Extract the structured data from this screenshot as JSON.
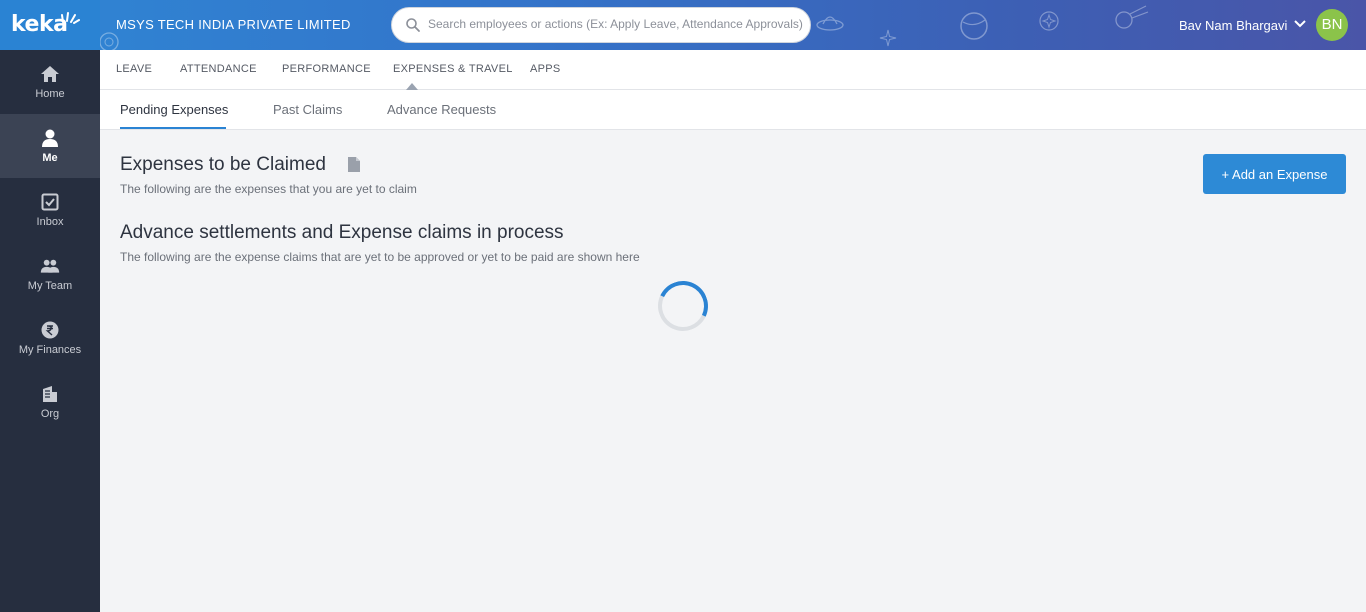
{
  "header": {
    "logo": "keka",
    "company": "MSYS TECH INDIA PRIVATE LIMITED",
    "search_placeholder": "Search employees or actions (Ex: Apply Leave, Attendance Approvals)",
    "user_name": "Bav Nam Bhargavi",
    "avatar_initials": "BN",
    "colors": {
      "header": "#2f86d4",
      "avatar": "#8bc34a",
      "accent": "#2a83d3"
    }
  },
  "sidebar": {
    "items": [
      {
        "label": "Home",
        "icon": "home-icon",
        "active": false
      },
      {
        "label": "Me",
        "icon": "person-icon",
        "active": true
      },
      {
        "label": "Inbox",
        "icon": "inbox-check-icon",
        "active": false
      },
      {
        "label": "My Team",
        "icon": "team-icon",
        "active": false
      },
      {
        "label": "My Finances",
        "icon": "rupee-icon",
        "active": false
      },
      {
        "label": "Org",
        "icon": "building-icon",
        "active": false
      }
    ]
  },
  "mainnav": {
    "items": [
      "LEAVE",
      "ATTENDANCE",
      "PERFORMANCE",
      "EXPENSES & TRAVEL",
      "APPS"
    ],
    "active": "EXPENSES & TRAVEL"
  },
  "subtabs": {
    "items": [
      "Pending Expenses",
      "Past Claims",
      "Advance Requests"
    ],
    "active": "Pending Expenses"
  },
  "content": {
    "section1_title": "Expenses to be Claimed",
    "section1_sub": "The following are the expenses that you are yet to claim",
    "add_button": "+ Add an Expense",
    "section2_title": "Advance settlements and Expense claims in process",
    "section2_sub": "The following are the expense claims that are yet to be approved or yet to be paid are shown here"
  }
}
